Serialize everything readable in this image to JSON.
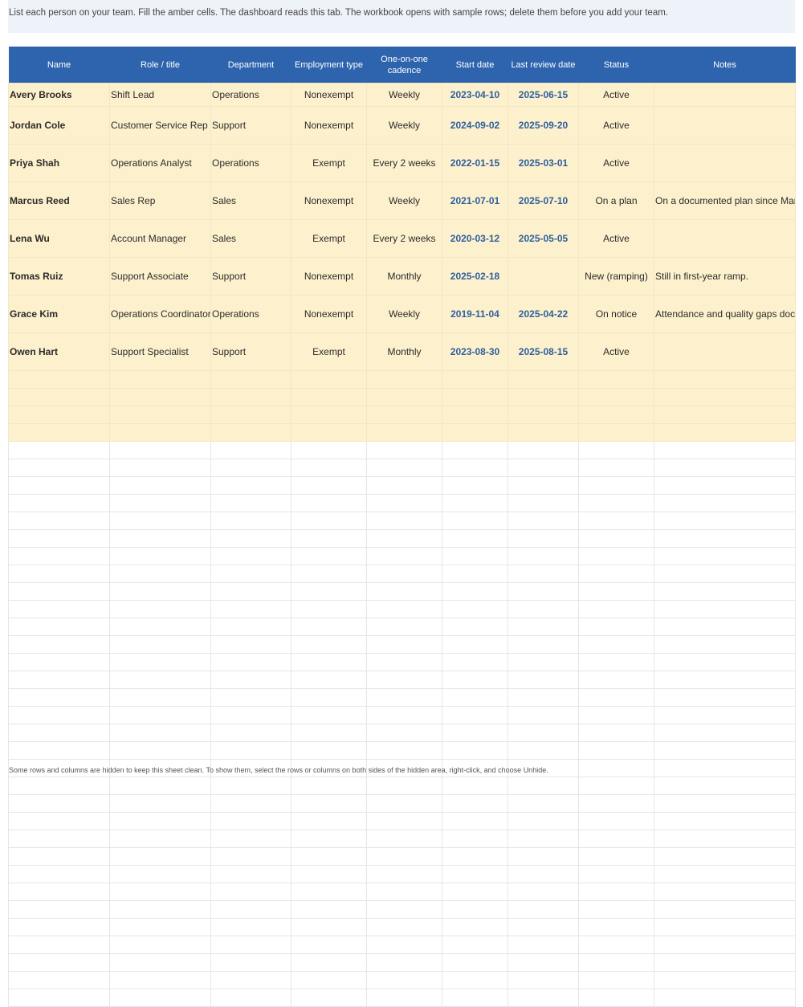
{
  "banner": "List each person on your team. Fill the amber cells. The dashboard reads this tab. The workbook opens with sample rows; delete them before you add your team.",
  "headers": {
    "name": "Name",
    "role": "Role / title",
    "department": "Department",
    "employment_type": "Employment type",
    "cadence_line1": "One-on-one",
    "cadence_line2": "cadence",
    "start_date": "Start date",
    "last_review": "Last review date",
    "status": "Status",
    "notes": "Notes"
  },
  "rows": [
    {
      "name": "Avery Brooks",
      "role": "Shift Lead",
      "department": "Operations",
      "type": "Nonexempt",
      "cadence": "Weekly",
      "start": "2023-04-10",
      "review": "2025-06-15",
      "status": "Active",
      "notes": ""
    },
    {
      "name": "Jordan Cole",
      "role": "Customer Service Rep",
      "department": "Support",
      "type": "Nonexempt",
      "cadence": "Weekly",
      "start": "2024-09-02",
      "review": "2025-09-20",
      "status": "Active",
      "notes": ""
    },
    {
      "name": "Priya Shah",
      "role": "Operations Analyst",
      "department": "Operations",
      "type": "Exempt",
      "cadence": "Every 2 weeks",
      "start": "2022-01-15",
      "review": "2025-03-01",
      "status": "Active",
      "notes": ""
    },
    {
      "name": "Marcus Reed",
      "role": "Sales Rep",
      "department": "Sales",
      "type": "Nonexempt",
      "cadence": "Weekly",
      "start": "2021-07-01",
      "review": "2025-07-10",
      "status": "On a plan",
      "notes": "On a documented plan since March."
    },
    {
      "name": "Lena Wu",
      "role": "Account Manager",
      "department": "Sales",
      "type": "Exempt",
      "cadence": "Every 2 weeks",
      "start": "2020-03-12",
      "review": "2025-05-05",
      "status": "Active",
      "notes": ""
    },
    {
      "name": "Tomas Ruiz",
      "role": "Support Associate",
      "department": "Support",
      "type": "Nonexempt",
      "cadence": "Monthly",
      "start": "2025-02-18",
      "review": "",
      "status": "New (ramping)",
      "notes": "Still in first-year ramp."
    },
    {
      "name": "Grace Kim",
      "role": "Operations Coordinator",
      "department": "Operations",
      "type": "Nonexempt",
      "cadence": "Weekly",
      "start": "2019-11-04",
      "review": "2025-04-22",
      "status": "On notice",
      "notes": "Attendance and quality gaps documented."
    },
    {
      "name": "Owen Hart",
      "role": "Support Specialist",
      "department": "Support",
      "type": "Exempt",
      "cadence": "Monthly",
      "start": "2023-08-30",
      "review": "2025-08-15",
      "status": "Active",
      "notes": ""
    }
  ],
  "footer": "Some rows and columns are hidden to keep this sheet clean. To show them, select the rows or columns on both sides of the hidden area, right-click, and choose Unhide."
}
